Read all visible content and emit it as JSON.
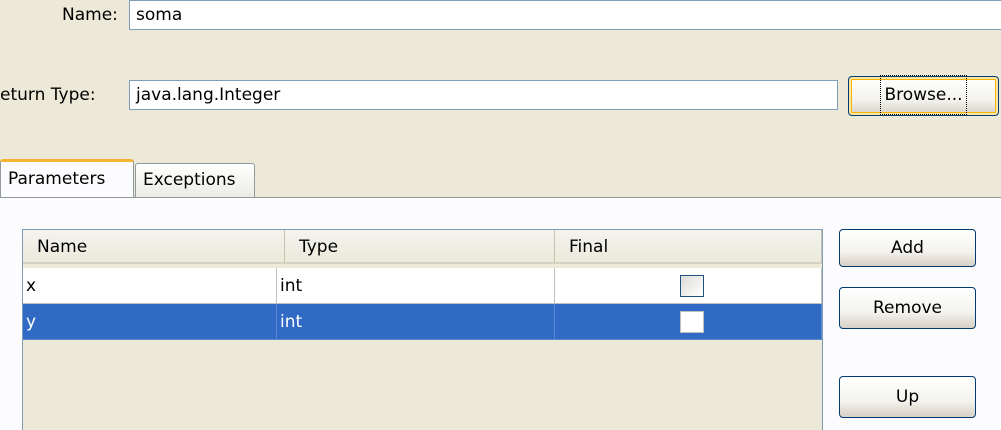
{
  "form": {
    "name_label": "Name:",
    "name_value": "soma",
    "return_type_label": "eturn Type:",
    "return_type_value": "java.lang.Integer",
    "browse_label": "Browse..."
  },
  "tabs": [
    {
      "label": "Parameters",
      "active": true
    },
    {
      "label": "Exceptions",
      "active": false
    }
  ],
  "parameters_table": {
    "columns": [
      "Name",
      "Type",
      "Final"
    ],
    "rows": [
      {
        "name": "x",
        "type": "int",
        "final": false,
        "selected": false
      },
      {
        "name": "y",
        "type": "int",
        "final": false,
        "selected": true
      }
    ]
  },
  "actions": {
    "add_label": "Add",
    "remove_label": "Remove",
    "up_label": "Up"
  },
  "colors": {
    "window_bg": "#ece9d8",
    "selection": "#316ac5",
    "active_tab_accent": "#f6b531"
  }
}
